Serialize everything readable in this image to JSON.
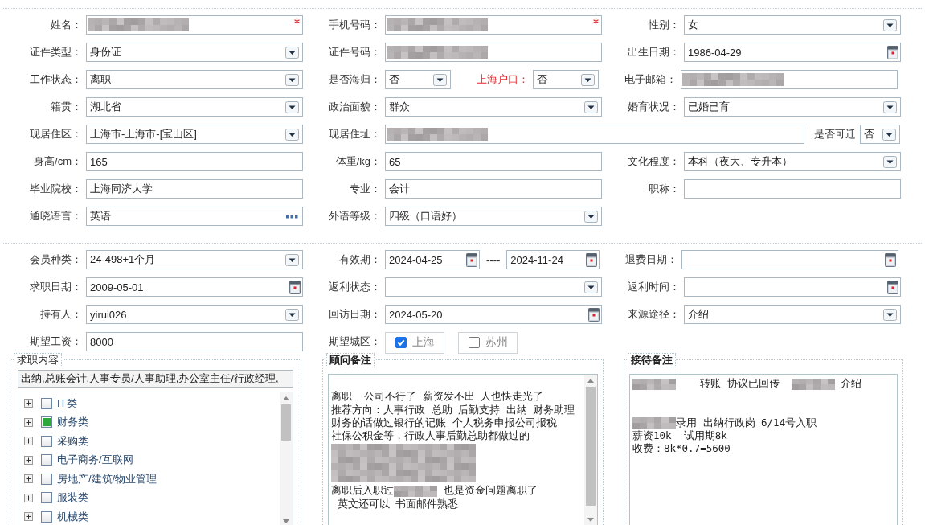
{
  "personal_info": {
    "rows": [
      {
        "cells": [
          {
            "label": "姓名：",
            "kind": "text",
            "redacted": true,
            "required": true
          },
          {
            "label": "手机号码：",
            "kind": "text",
            "redacted": true,
            "required": true
          },
          {
            "label": "性别：",
            "kind": "select",
            "value": "女"
          }
        ]
      },
      {
        "cells": [
          {
            "label": "证件类型：",
            "kind": "select",
            "value": "身份证"
          },
          {
            "label": "证件号码：",
            "kind": "text",
            "redacted": true
          },
          {
            "label": "出生日期：",
            "kind": "date",
            "value": "1986-04-29"
          }
        ]
      },
      {
        "cells": [
          {
            "label": "工作状态：",
            "kind": "select",
            "value": "离职"
          },
          {
            "label": "是否海归：",
            "kind": "compact_select",
            "value": "否"
          },
          {
            "label": "上海户口：",
            "kind": "compact_select",
            "value": "否",
            "highlight": true
          },
          {
            "label": "电子邮箱：",
            "kind": "text",
            "redacted": true
          }
        ]
      },
      {
        "cells": [
          {
            "label": "籍贯：",
            "kind": "select",
            "value": "湖北省"
          },
          {
            "label": "政治面貌：",
            "kind": "select",
            "value": "群众"
          },
          {
            "label": "婚育状况：",
            "kind": "select",
            "value": "已婚已育"
          }
        ]
      },
      {
        "cells": [
          {
            "label": "现居住区：",
            "kind": "select",
            "value": "上海市-上海市-[宝山区]"
          },
          {
            "label": "现居住址：",
            "kind": "address",
            "redacted": true
          },
          {
            "label": "是否可迁",
            "kind": "mini_select",
            "value": "否"
          }
        ]
      },
      {
        "cells": [
          {
            "label": "身高/cm：",
            "kind": "text",
            "value": "165"
          },
          {
            "label": "体重/kg：",
            "kind": "text",
            "value": "65"
          },
          {
            "label": "文化程度：",
            "kind": "select",
            "value": "本科（夜大、专升本）"
          }
        ]
      },
      {
        "cells": [
          {
            "label": "毕业院校：",
            "kind": "text",
            "value": "上海同济大学"
          },
          {
            "label": "专业：",
            "kind": "text",
            "value": "会计"
          },
          {
            "label": "职称：",
            "kind": "text"
          }
        ]
      },
      {
        "cells": [
          {
            "label": "通晓语言：",
            "kind": "lookup",
            "value": "英语"
          },
          {
            "label": "外语等级：",
            "kind": "select",
            "value": "四级（口语好）"
          }
        ]
      }
    ]
  },
  "membership": {
    "rows": [
      {
        "cells": [
          {
            "label": "会员种类：",
            "kind": "select",
            "value": "24-498+1个月"
          },
          {
            "label": "有效期：",
            "kind": "date_range",
            "value": "2024-04-25",
            "separator": "----",
            "value2": "2024-11-24"
          },
          {
            "label": "退费日期：",
            "kind": "date"
          }
        ]
      },
      {
        "cells": [
          {
            "label": "求职日期：",
            "kind": "date",
            "value": "2009-05-01"
          },
          {
            "label": "返利状态：",
            "kind": "select"
          },
          {
            "label": "返利时间：",
            "kind": "date"
          }
        ]
      },
      {
        "cells": [
          {
            "label": "持有人：",
            "kind": "select",
            "value": "yirui026"
          },
          {
            "label": "回访日期：",
            "kind": "date",
            "value": "2024-05-20"
          },
          {
            "label": "来源途径：",
            "kind": "select",
            "value": "介绍"
          }
        ]
      },
      {
        "cells": [
          {
            "label": "期望工资：",
            "kind": "text",
            "value": "8000"
          },
          {
            "label": "期望城区：",
            "kind": "checkbox_group",
            "options": [
              {
                "label": "上海",
                "checked": true
              },
              {
                "label": "苏州",
                "checked": false
              }
            ]
          }
        ]
      }
    ]
  },
  "job_intent": {
    "legend": "求职内容",
    "selected_text": "出纳,总账会计,人事专员/人事助理,办公室主任/行政经理,",
    "tree": [
      {
        "label": "IT类",
        "checked": false,
        "expanded": false
      },
      {
        "label": "财务类",
        "checked": true,
        "expanded": false
      },
      {
        "label": "采购类",
        "checked": false,
        "expanded": false
      },
      {
        "label": "电子商务/互联网",
        "checked": false,
        "expanded": false
      },
      {
        "label": "房地产/建筑/物业管理",
        "checked": false,
        "expanded": false
      },
      {
        "label": "服装类",
        "checked": false,
        "expanded": false
      },
      {
        "label": "机械类",
        "checked": false,
        "expanded": false
      }
    ]
  },
  "advisor_notes": {
    "legend": "顾问备注",
    "lines": [
      {
        "kind": "blank"
      },
      {
        "kind": "text",
        "segments": [
          {
            "kind": "text",
            "text": "离职  公司不行了 薪资发不出 人也快走光了"
          }
        ]
      },
      {
        "kind": "text",
        "segments": [
          {
            "kind": "text",
            "text": "推荐方向：人事行政 总助 后勤支持 出纳 财务助理"
          }
        ]
      },
      {
        "kind": "text",
        "segments": [
          {
            "kind": "text",
            "text": "财务的话做过银行的记账 个人税务申报公司报税"
          }
        ]
      },
      {
        "kind": "text",
        "segments": [
          {
            "kind": "text",
            "text": "社保公积金等，行政人事后勤总助都做过的"
          }
        ]
      },
      {
        "kind": "redacted_block"
      },
      {
        "kind": "text",
        "segments": [
          {
            "kind": "text",
            "text": "离职后入职过"
          },
          {
            "kind": "redacted"
          },
          {
            "kind": "text",
            "text": " 也是资金问题离职了"
          }
        ]
      },
      {
        "kind": "text",
        "segments": [
          {
            "kind": "text",
            "text": " 英文还可以 书面邮件熟悉"
          }
        ]
      }
    ]
  },
  "reception_notes": {
    "legend": "接待备注",
    "lines": [
      {
        "kind": "text",
        "segments": [
          {
            "kind": "redacted"
          },
          {
            "kind": "text",
            "text": "    转账 协议已回传  "
          },
          {
            "kind": "redacted"
          },
          {
            "kind": "text",
            "text": " 介绍"
          }
        ]
      },
      {
        "kind": "blank"
      },
      {
        "kind": "blank"
      },
      {
        "kind": "text",
        "segments": [
          {
            "kind": "redacted"
          },
          {
            "kind": "text",
            "text": "录用 出纳行政岗 6/14号入职"
          }
        ]
      },
      {
        "kind": "text",
        "segments": [
          {
            "kind": "text",
            "text": "薪资10k  试用期8k"
          }
        ]
      },
      {
        "kind": "text",
        "segments": [
          {
            "kind": "text",
            "text": "收费：8k*0.7=5600"
          }
        ]
      }
    ]
  }
}
